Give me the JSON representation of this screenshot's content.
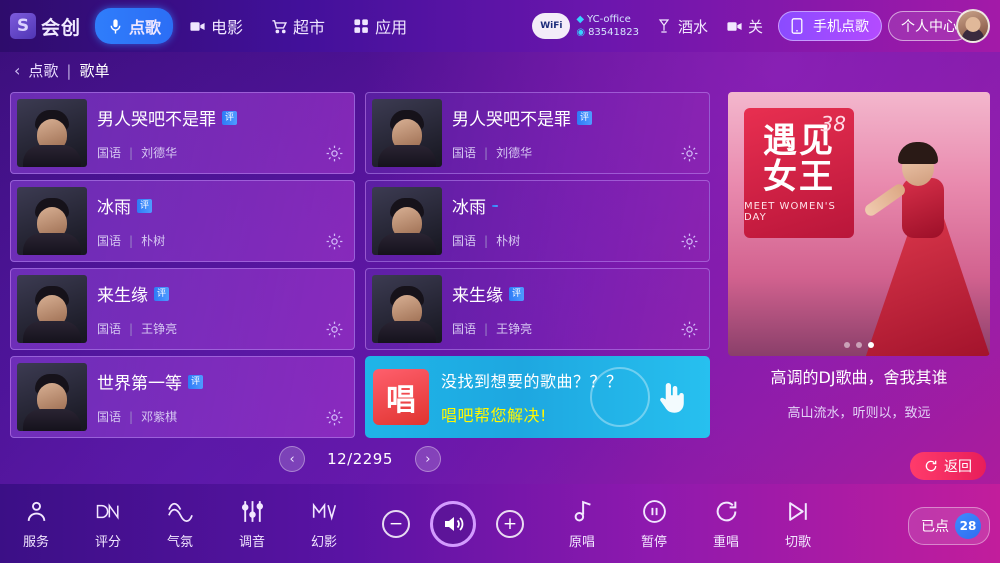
{
  "topbar": {
    "logo_text": "会创",
    "nav": [
      {
        "label": "点歌",
        "icon": "mic-icon",
        "active": true
      },
      {
        "label": "电影",
        "icon": "video-icon",
        "active": false
      },
      {
        "label": "超市",
        "icon": "cart-icon",
        "active": false
      },
      {
        "label": "应用",
        "icon": "grid-icon",
        "active": false
      }
    ],
    "wifi_label": "WiFi",
    "network_name": "YC-office",
    "network_id": "83541823",
    "drinks_label": "酒水",
    "close_label": "关",
    "phone_order_label": "手机点歌",
    "user_center_label": "个人中心"
  },
  "breadcrumb": {
    "back_icon": "chevron-left-icon",
    "root": "点歌",
    "separator": "|",
    "current": "歌单"
  },
  "songs": [
    {
      "title": "男人哭吧不是罪",
      "tag": "评",
      "lang": "国语",
      "artist": "刘德华",
      "highlight": true
    },
    {
      "title": "男人哭吧不是罪",
      "tag": "评",
      "lang": "国语",
      "artist": "刘德华",
      "highlight": false
    },
    {
      "title": "冰雨",
      "tag": "评",
      "lang": "国语",
      "artist": "朴树",
      "highlight": true
    },
    {
      "title": "冰雨",
      "tag": "",
      "lang": "国语",
      "artist": "朴树",
      "highlight": false
    },
    {
      "title": "来生缘",
      "tag": "评",
      "lang": "国语",
      "artist": "王铮亮",
      "highlight": true
    },
    {
      "title": "来生缘",
      "tag": "评",
      "lang": "国语",
      "artist": "王铮亮",
      "highlight": false
    },
    {
      "title": "世界第一等",
      "tag": "评",
      "lang": "国语",
      "artist": "邓紫棋",
      "highlight": true
    }
  ],
  "promo": {
    "icon_char": "唱",
    "line1": "没找到想要的歌曲？？？",
    "line2": "唱吧帮您解决!",
    "hand_icon": "hand-tap-icon"
  },
  "ad": {
    "badge_number": "38",
    "badge_line1": "遇见",
    "badge_line2": "女王",
    "badge_sub": "MEET WOMEN'S DAY",
    "dots": [
      false,
      false,
      true
    ],
    "caption1": "高调的DJ歌曲，舍我其谁",
    "caption2": "高山流水，听则以，致远"
  },
  "pager": {
    "prev_icon": "chevron-left-icon",
    "next_icon": "chevron-right-icon",
    "text": "12/2295"
  },
  "return_button": {
    "label": "返回",
    "icon": "refresh-icon"
  },
  "bottom": {
    "left_functions": [
      {
        "label": "服务",
        "icon": "person-icon"
      },
      {
        "label": "评分",
        "icon": "score-icon"
      },
      {
        "label": "气氛",
        "icon": "mood-icon"
      },
      {
        "label": "调音",
        "icon": "equalizer-icon"
      },
      {
        "label": "幻影",
        "icon": "mv-icon"
      }
    ],
    "volume": {
      "minus_icon": "minus-icon",
      "speaker_icon": "speaker-icon",
      "plus_icon": "plus-icon"
    },
    "right_functions": [
      {
        "label": "原唱",
        "icon": "original-vocal-icon"
      },
      {
        "label": "暂停",
        "icon": "pause-icon"
      },
      {
        "label": "重唱",
        "icon": "replay-icon"
      },
      {
        "label": "切歌",
        "icon": "next-track-icon"
      }
    ],
    "selected_label": "已点",
    "selected_count": "28"
  },
  "colors": {
    "accent_blue": "#2f7dfb",
    "accent_pink": "#e81e5a",
    "promo_cyan": "#1fb5e8",
    "highlight_yellow": "#fff700"
  }
}
